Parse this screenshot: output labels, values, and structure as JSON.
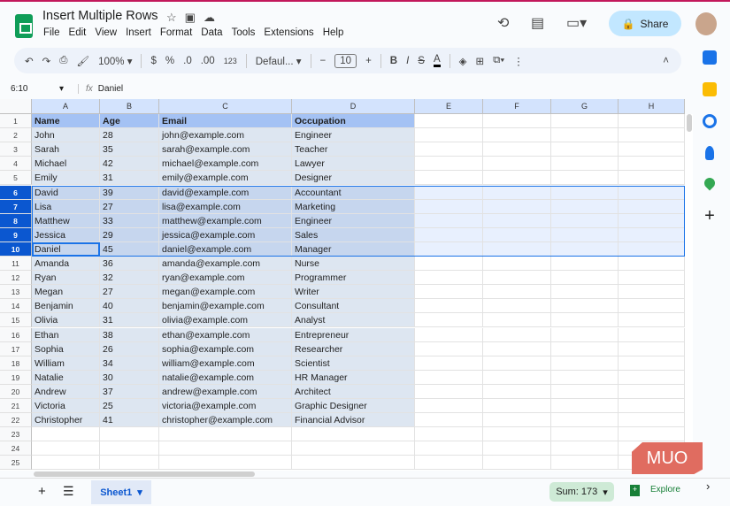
{
  "doc_title": "Insert Multiple Rows",
  "menu": [
    "File",
    "Edit",
    "View",
    "Insert",
    "Format",
    "Data",
    "Tools",
    "Extensions",
    "Help"
  ],
  "share_label": "Share",
  "toolbar": {
    "zoom": "100%",
    "currency": "$",
    "percent": "%",
    "dec_dec": ".0",
    "inc_dec": ".00",
    "format_123": "123",
    "font": "Defaul...",
    "font_size": "10",
    "bold": "B",
    "italic": "I"
  },
  "name_box": "6:10",
  "formula": "Daniel",
  "columns": [
    "A",
    "B",
    "C",
    "D",
    "E",
    "F",
    "G",
    "H"
  ],
  "header_row": [
    "Name",
    "Age",
    "Email",
    "Occupation"
  ],
  "rows": [
    [
      "John",
      "28",
      "john@example.com",
      "Engineer"
    ],
    [
      "Sarah",
      "35",
      "sarah@example.com",
      "Teacher"
    ],
    [
      "Michael",
      "42",
      "michael@example.com",
      "Lawyer"
    ],
    [
      "Emily",
      "31",
      "emily@example.com",
      "Designer"
    ],
    [
      "David",
      "39",
      "david@example.com",
      "Accountant"
    ],
    [
      "Lisa",
      "27",
      "lisa@example.com",
      "Marketing"
    ],
    [
      "Matthew",
      "33",
      "matthew@example.com",
      "Engineer"
    ],
    [
      "Jessica",
      "29",
      "jessica@example.com",
      "Sales"
    ],
    [
      "Daniel",
      "45",
      "daniel@example.com",
      "Manager"
    ],
    [
      "Amanda",
      "36",
      "amanda@example.com",
      "Nurse"
    ],
    [
      "Ryan",
      "32",
      "ryan@example.com",
      "Programmer"
    ],
    [
      "Megan",
      "27",
      "megan@example.com",
      "Writer"
    ],
    [
      "Benjamin",
      "40",
      "benjamin@example.com",
      "Consultant"
    ],
    [
      "Olivia",
      "31",
      "olivia@example.com",
      "Analyst"
    ],
    [
      "Ethan",
      "38",
      "ethan@example.com",
      "Entrepreneur"
    ],
    [
      "Sophia",
      "26",
      "sophia@example.com",
      "Researcher"
    ],
    [
      "William",
      "34",
      "william@example.com",
      "Scientist"
    ],
    [
      "Natalie",
      "30",
      "natalie@example.com",
      "HR Manager"
    ],
    [
      "Andrew",
      "37",
      "andrew@example.com",
      "Architect"
    ],
    [
      "Victoria",
      "25",
      "victoria@example.com",
      "Graphic Designer"
    ],
    [
      "Christopher",
      "41",
      "christopher@example.com",
      "Financial Advisor"
    ]
  ],
  "total_rows": 25,
  "selected_rows": [
    6,
    10
  ],
  "sheet_tab": "Sheet1",
  "sum_label": "Sum: 173",
  "explore_label": "Explore",
  "watermark": "MUO"
}
